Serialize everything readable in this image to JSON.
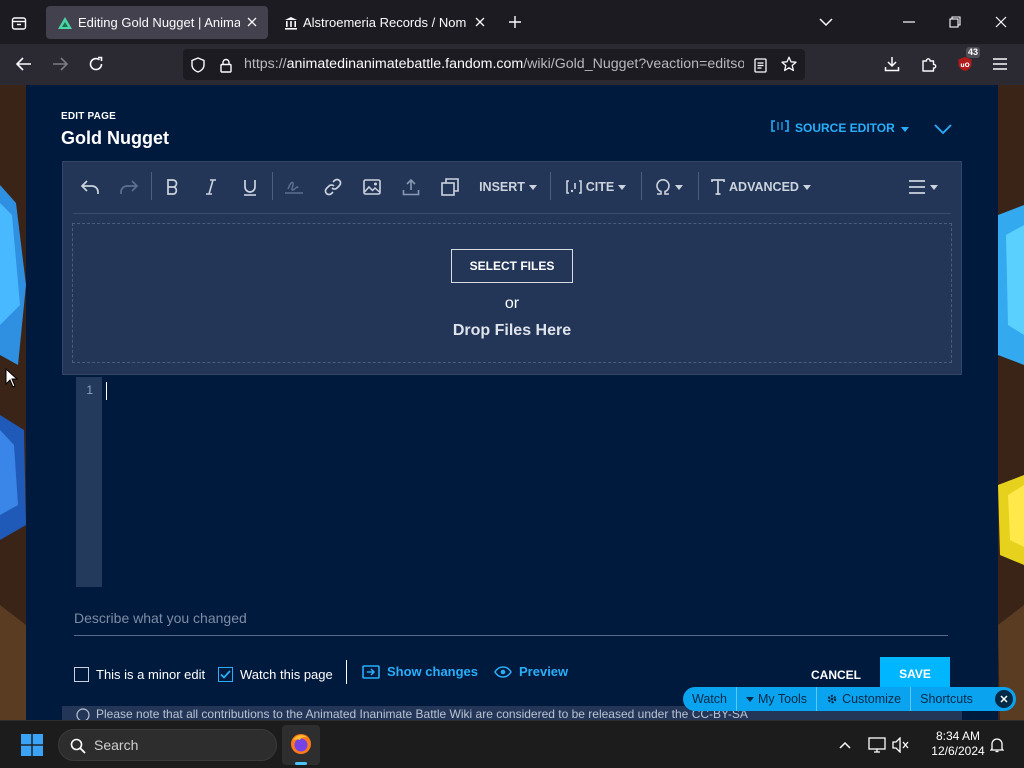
{
  "browser": {
    "tabs": [
      {
        "title": "Editing Gold Nugget | Animated Inanimate Battle Wiki | Fandom",
        "active": true
      },
      {
        "title": "Alstroemeria Records / Nomico",
        "active": false
      }
    ],
    "url": {
      "prefix": "https://",
      "host": "animatedinanimatebattle.fandom.com",
      "path": "/wiki/Gold_Nugget?veaction=editsource"
    },
    "extension_badge": "43"
  },
  "editor": {
    "mode_label": "EDIT PAGE",
    "page_title": "Gold Nugget",
    "source_editor_label": "SOURCE EDITOR",
    "toolbar": {
      "insert_label": "INSERT",
      "cite_label": "CITE",
      "advanced_label": "ADVANCED"
    },
    "upload": {
      "select_files_label": "SELECT FILES",
      "or_label": "or",
      "drop_label": "Drop Files Here"
    },
    "line_number": "1",
    "summary_placeholder": "Describe what you changed",
    "minor_edit_label": "This is a minor edit",
    "minor_edit_checked": false,
    "watch_label": "Watch this page",
    "watch_checked": true,
    "show_changes_label": "Show changes",
    "preview_label": "Preview",
    "cancel_label": "CANCEL",
    "save_label": "SAVE",
    "license_notice": "Please note that all contributions to the Animated Inanimate Battle Wiki are considered to be released under the CC-BY-SA"
  },
  "fandom_toolbar": {
    "watch_label": "Watch",
    "my_tools_label": "My Tools",
    "customize_label": "Customize",
    "shortcuts_label": "Shortcuts"
  },
  "taskbar": {
    "search_placeholder": "Search",
    "time": "8:34 AM",
    "date": "12/6/2024"
  },
  "colors": {
    "accent": "#29aef9",
    "page_bg": "#001a3e",
    "toolbar_bg": "#233657",
    "save_button": "#00b7ff"
  }
}
